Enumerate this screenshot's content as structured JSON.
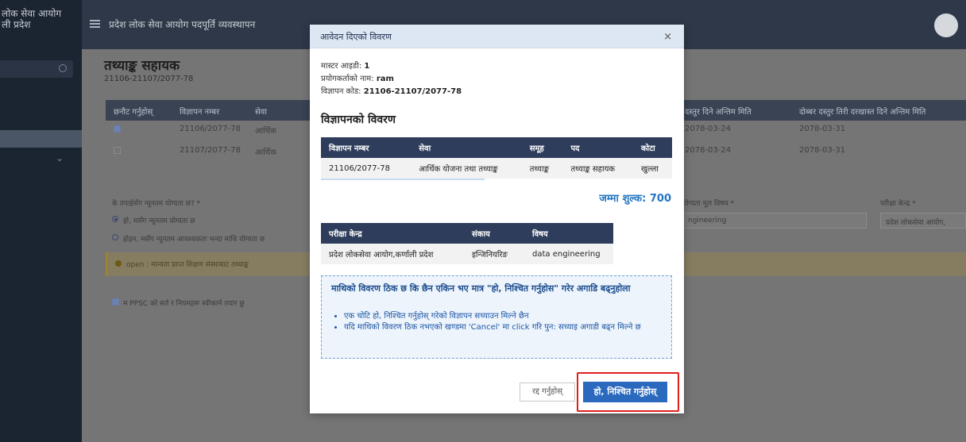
{
  "sidebar": {
    "brand": "लोक सेवा आयोग\nली प्रदेश"
  },
  "topbar": {
    "title": "प्रदेश लोक सेवा आयोग पदपूर्ति व्यवस्थापन"
  },
  "page": {
    "title": "तथ्याङ्क सहायक",
    "subtitle": "21106-21107/2077-78",
    "table_headers": [
      "छनौट गर्नुहोस्",
      "विज्ञापन नम्बर",
      "सेवा",
      "दस्तुर दिने अन्तिम मिति",
      "दोब्बर दस्तुर तिरी दरखास्त दिने अन्तिम मिति"
    ],
    "rows": [
      {
        "checked": true,
        "number": "21106/2077-78",
        "service": "आर्थिक",
        "deadline": "2078-03-24",
        "double_deadline": "2078-03-31"
      },
      {
        "checked": false,
        "number": "21107/2077-78",
        "service": "आर्थिक",
        "deadline": "2078-03-24",
        "double_deadline": "2078-03-31"
      }
    ],
    "question": "के तपाईसँग न्यूनतम योग्यता छ? *",
    "option_yes": "हो, मसँग न्यूनतम योग्यता छ",
    "option_no": "होइन, मसँग न्यूनतम आवश्यकता भन्दा माथि योग्यता छ",
    "warning": "open : मान्यता प्राप्त शिक्षण संस्थाबाट तथ्याङ्क",
    "agree": "म PPSC को सर्त र नियमहरू स्वीकार्न तयार छु",
    "field_subject_label": "योग्यता मूल विषय *",
    "field_subject_value": "ngineering",
    "field_center_label": "परीक्षा केन्द्र *",
    "field_center_value": "प्रदेश लोकसेवा आयोग,"
  },
  "modal": {
    "title": "आवेदन दिएको विवरण",
    "close": "×",
    "master_id_label": "मास्टर आइडी:",
    "master_id": "1",
    "user_label": "प्रयोगकर्ताको नाम:",
    "user": "ram",
    "code_label": "विज्ञापन कोड:",
    "code": "21106-21107/2077-78",
    "section_title": "विज्ञापनको विवरण",
    "ad_table": {
      "headers": [
        "विज्ञापन नम्बर",
        "सेवा",
        "समूह",
        "पद",
        "कोटा"
      ],
      "rows": [
        [
          "21106/2077-78",
          "आर्थिक योजना तथा तथ्याङ्क",
          "तथ्याङ्क",
          "तथ्याङ्क सहायक",
          "खुल्ला"
        ]
      ]
    },
    "total": "जम्मा शुल्क: 700",
    "exam_table": {
      "headers": [
        "परीक्षा केन्द्र",
        "संकाय",
        "विषय"
      ],
      "rows": [
        [
          "प्रदेश लोकसेवा आयोग,कर्णाली प्रदेश",
          "इन्जिनियरिङ",
          "data engineering"
        ]
      ]
    },
    "notice_head": "माथिको विवरण ठिक छ कि छैन एकिन भए मात्र \"हो, निश्चित गर्नुहोस\" गरेर अगाडि बढ्नुहोला",
    "notice_items": [
      "एक चोटि हो, निश्चित गर्नुहोस् गरेको विज्ञापन सच्याउन मिल्ने छैन",
      "यदि माथिको विवरण ठिक नभएको खण्डमा 'Cancel' मा click गरि पुन: सच्याइ अगाडी बढ्न मिल्ने छ"
    ],
    "cancel_label": "रद्द गर्नुहोस्",
    "confirm_label": "हो, निश्चित गर्नुहोस्",
    "highlight_color": "#e0201b"
  }
}
